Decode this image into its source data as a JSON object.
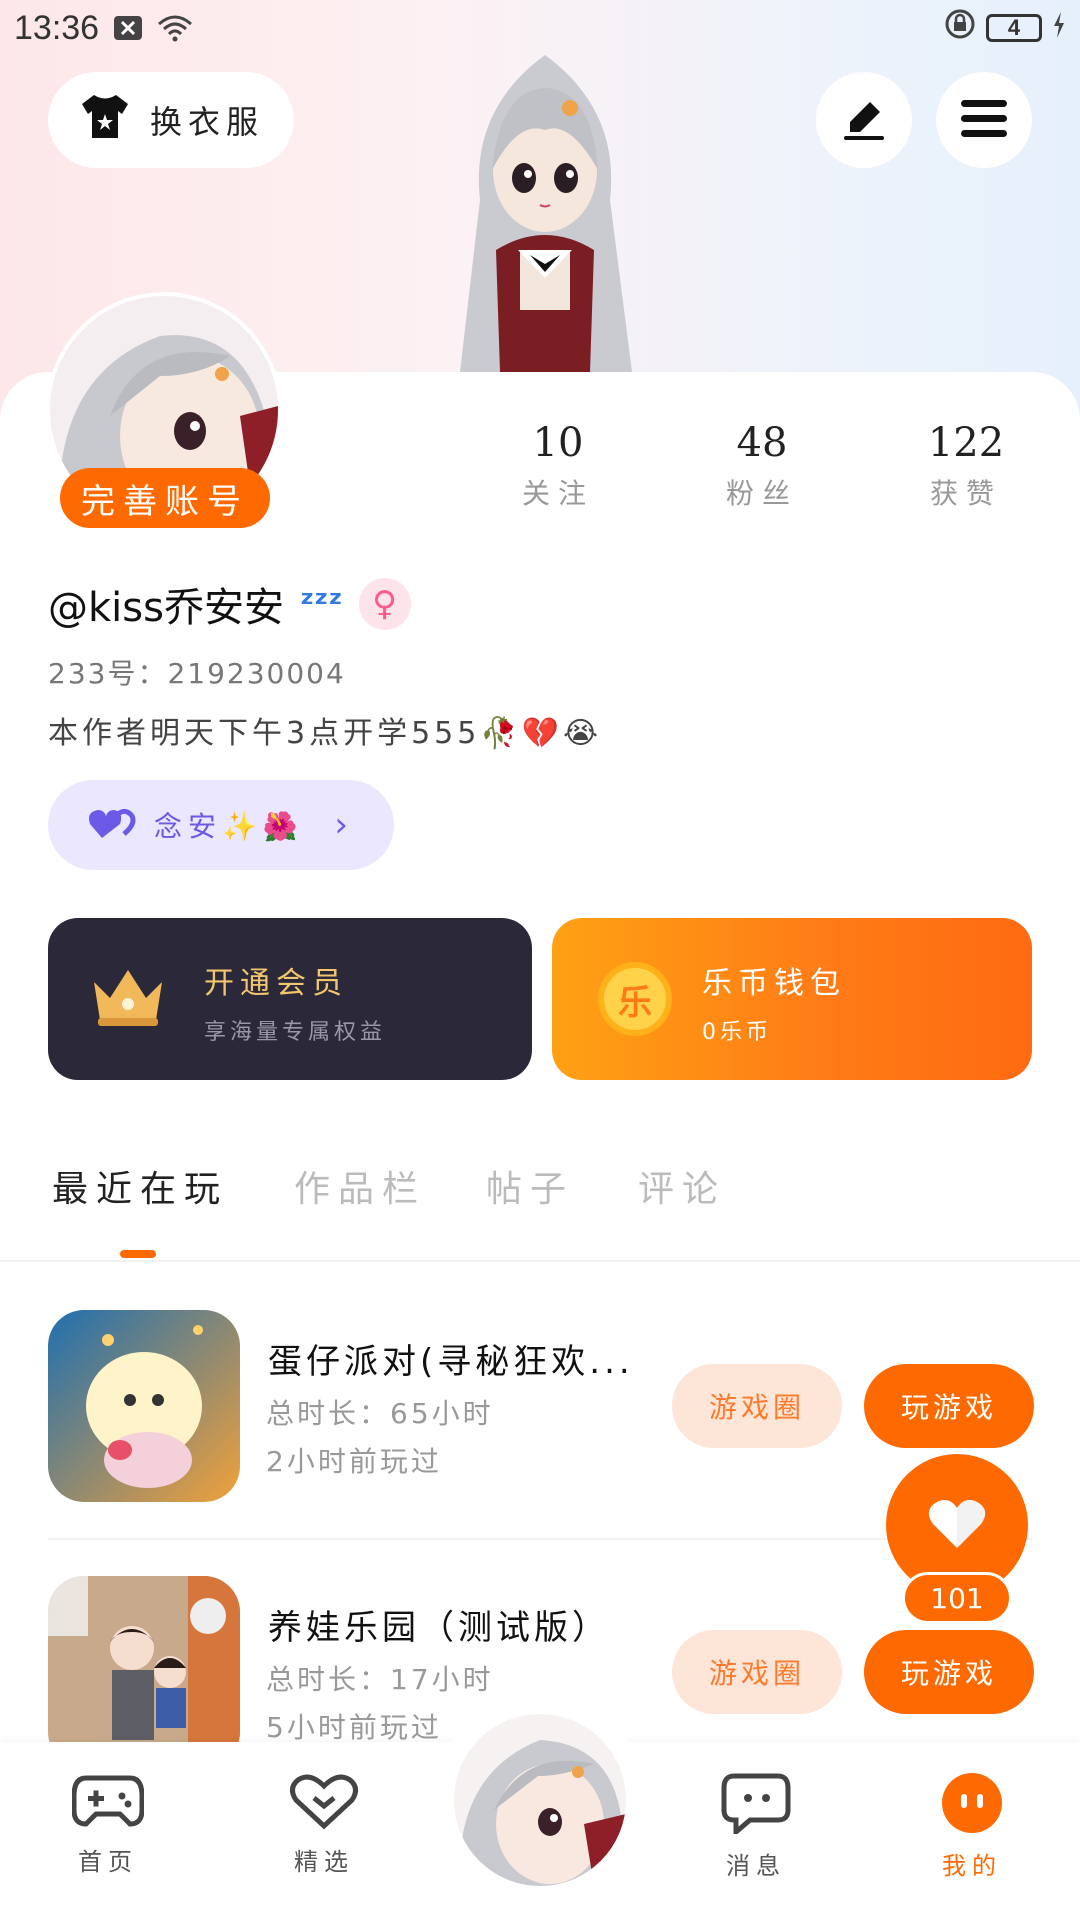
{
  "status_bar": {
    "time": "13:36",
    "battery": "4"
  },
  "header": {
    "outfit_label": "换衣服"
  },
  "profile": {
    "complete_label": "完善账号",
    "stats": [
      {
        "value": "10",
        "label": "关注"
      },
      {
        "value": "48",
        "label": "粉丝"
      },
      {
        "value": "122",
        "label": "获赞"
      }
    ],
    "username": "@kiss乔安安",
    "user_id": "233号：219230004",
    "bio": "本作者明天下午3点开学555🥀💔😭",
    "tag": "念安✨🌺"
  },
  "cards": {
    "vip": {
      "title": "开通会员",
      "subtitle": "享海量专属权益"
    },
    "wallet": {
      "title": "乐币钱包",
      "subtitle": "0乐币",
      "coin_glyph": "乐"
    }
  },
  "tabs": [
    "最近在玩",
    "作品栏",
    "帖子",
    "评论"
  ],
  "games": [
    {
      "title": "蛋仔派对(寻秘狂欢...",
      "duration": "总时长：65小时",
      "last_played": "2小时前玩过",
      "circle_label": "游戏圈",
      "play_label": "玩游戏"
    },
    {
      "title": "养娃乐园（测试版）",
      "duration": "总时长：17小时",
      "last_played": "5小时前玩过",
      "circle_label": "游戏圈",
      "play_label": "玩游戏"
    }
  ],
  "like_count": "101",
  "bottom_nav": [
    {
      "label": "首页",
      "icon": "gamepad-icon"
    },
    {
      "label": "精选",
      "icon": "heart-outline-icon"
    },
    {
      "label": "消息",
      "icon": "chat-icon"
    },
    {
      "label": "我的",
      "icon": "profile-face-icon"
    }
  ],
  "colors": {
    "accent": "#ff6a00",
    "vip_bg": "#2b2839",
    "tag_bg": "#ebe7ff"
  }
}
